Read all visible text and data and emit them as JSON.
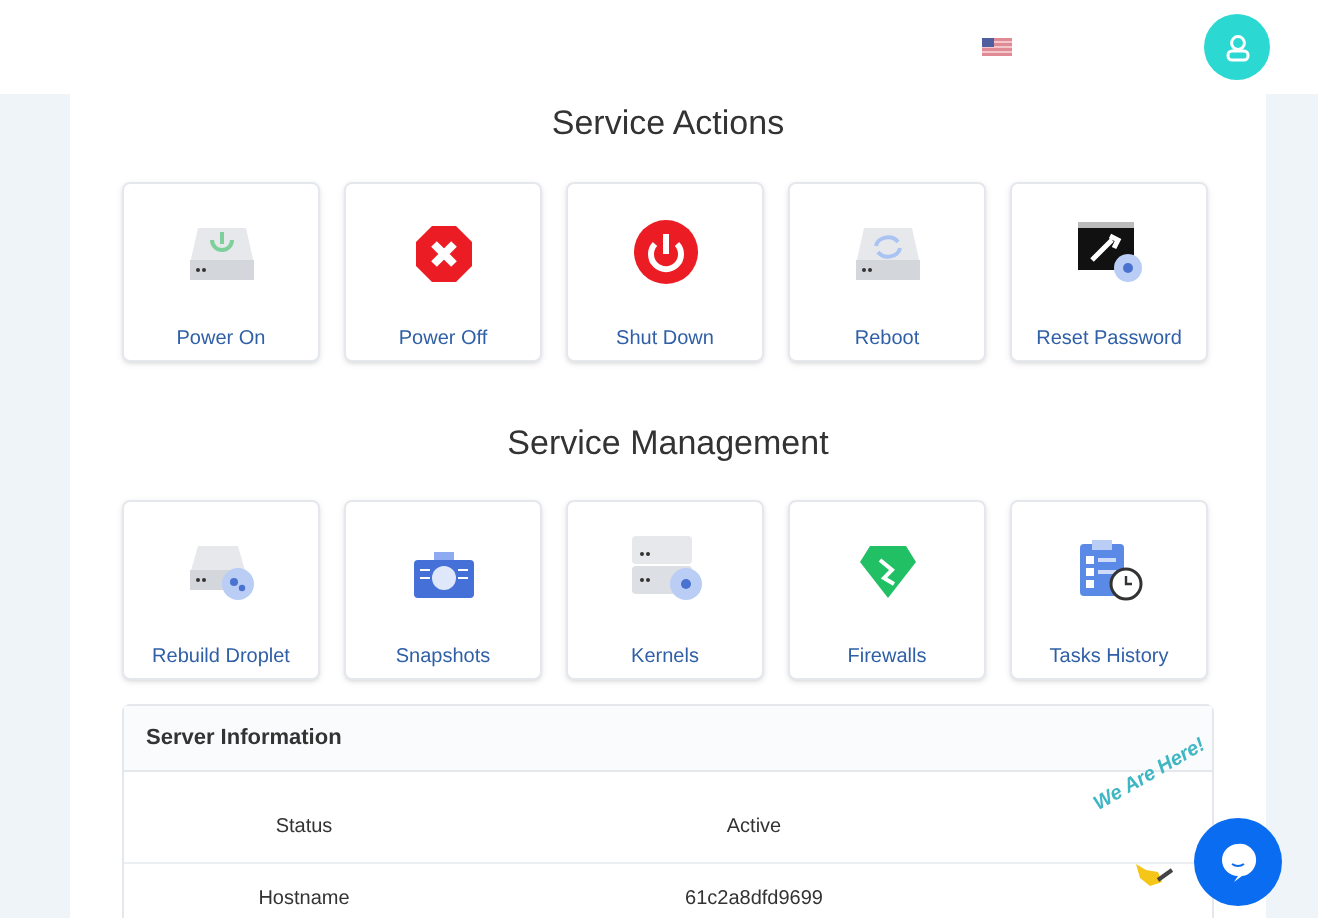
{
  "service_actions": {
    "title": "Service Actions",
    "tiles": [
      {
        "label": "Power On",
        "kind": "drive-power"
      },
      {
        "label": "Power Off",
        "kind": "stop"
      },
      {
        "label": "Shut Down",
        "kind": "power"
      },
      {
        "label": "Reboot",
        "kind": "drive-sync"
      },
      {
        "label": "Reset Password",
        "kind": "terminal-gear"
      }
    ]
  },
  "service_management": {
    "title": "Service Management",
    "tiles": [
      {
        "label": "Rebuild Droplet",
        "kind": "drive-gears"
      },
      {
        "label": "Snapshots",
        "kind": "camera"
      },
      {
        "label": "Kernels",
        "kind": "server-gear"
      },
      {
        "label": "Firewalls",
        "kind": "gem"
      },
      {
        "label": "Tasks History",
        "kind": "clipboard-clock"
      }
    ]
  },
  "server_information": {
    "title": "Server Information",
    "rows": [
      {
        "label": "Status",
        "value": "Active"
      },
      {
        "label": "Hostname",
        "value": "61c2a8dfd9699"
      }
    ]
  },
  "chat_widget": {
    "tagline": "We Are Here!"
  }
}
